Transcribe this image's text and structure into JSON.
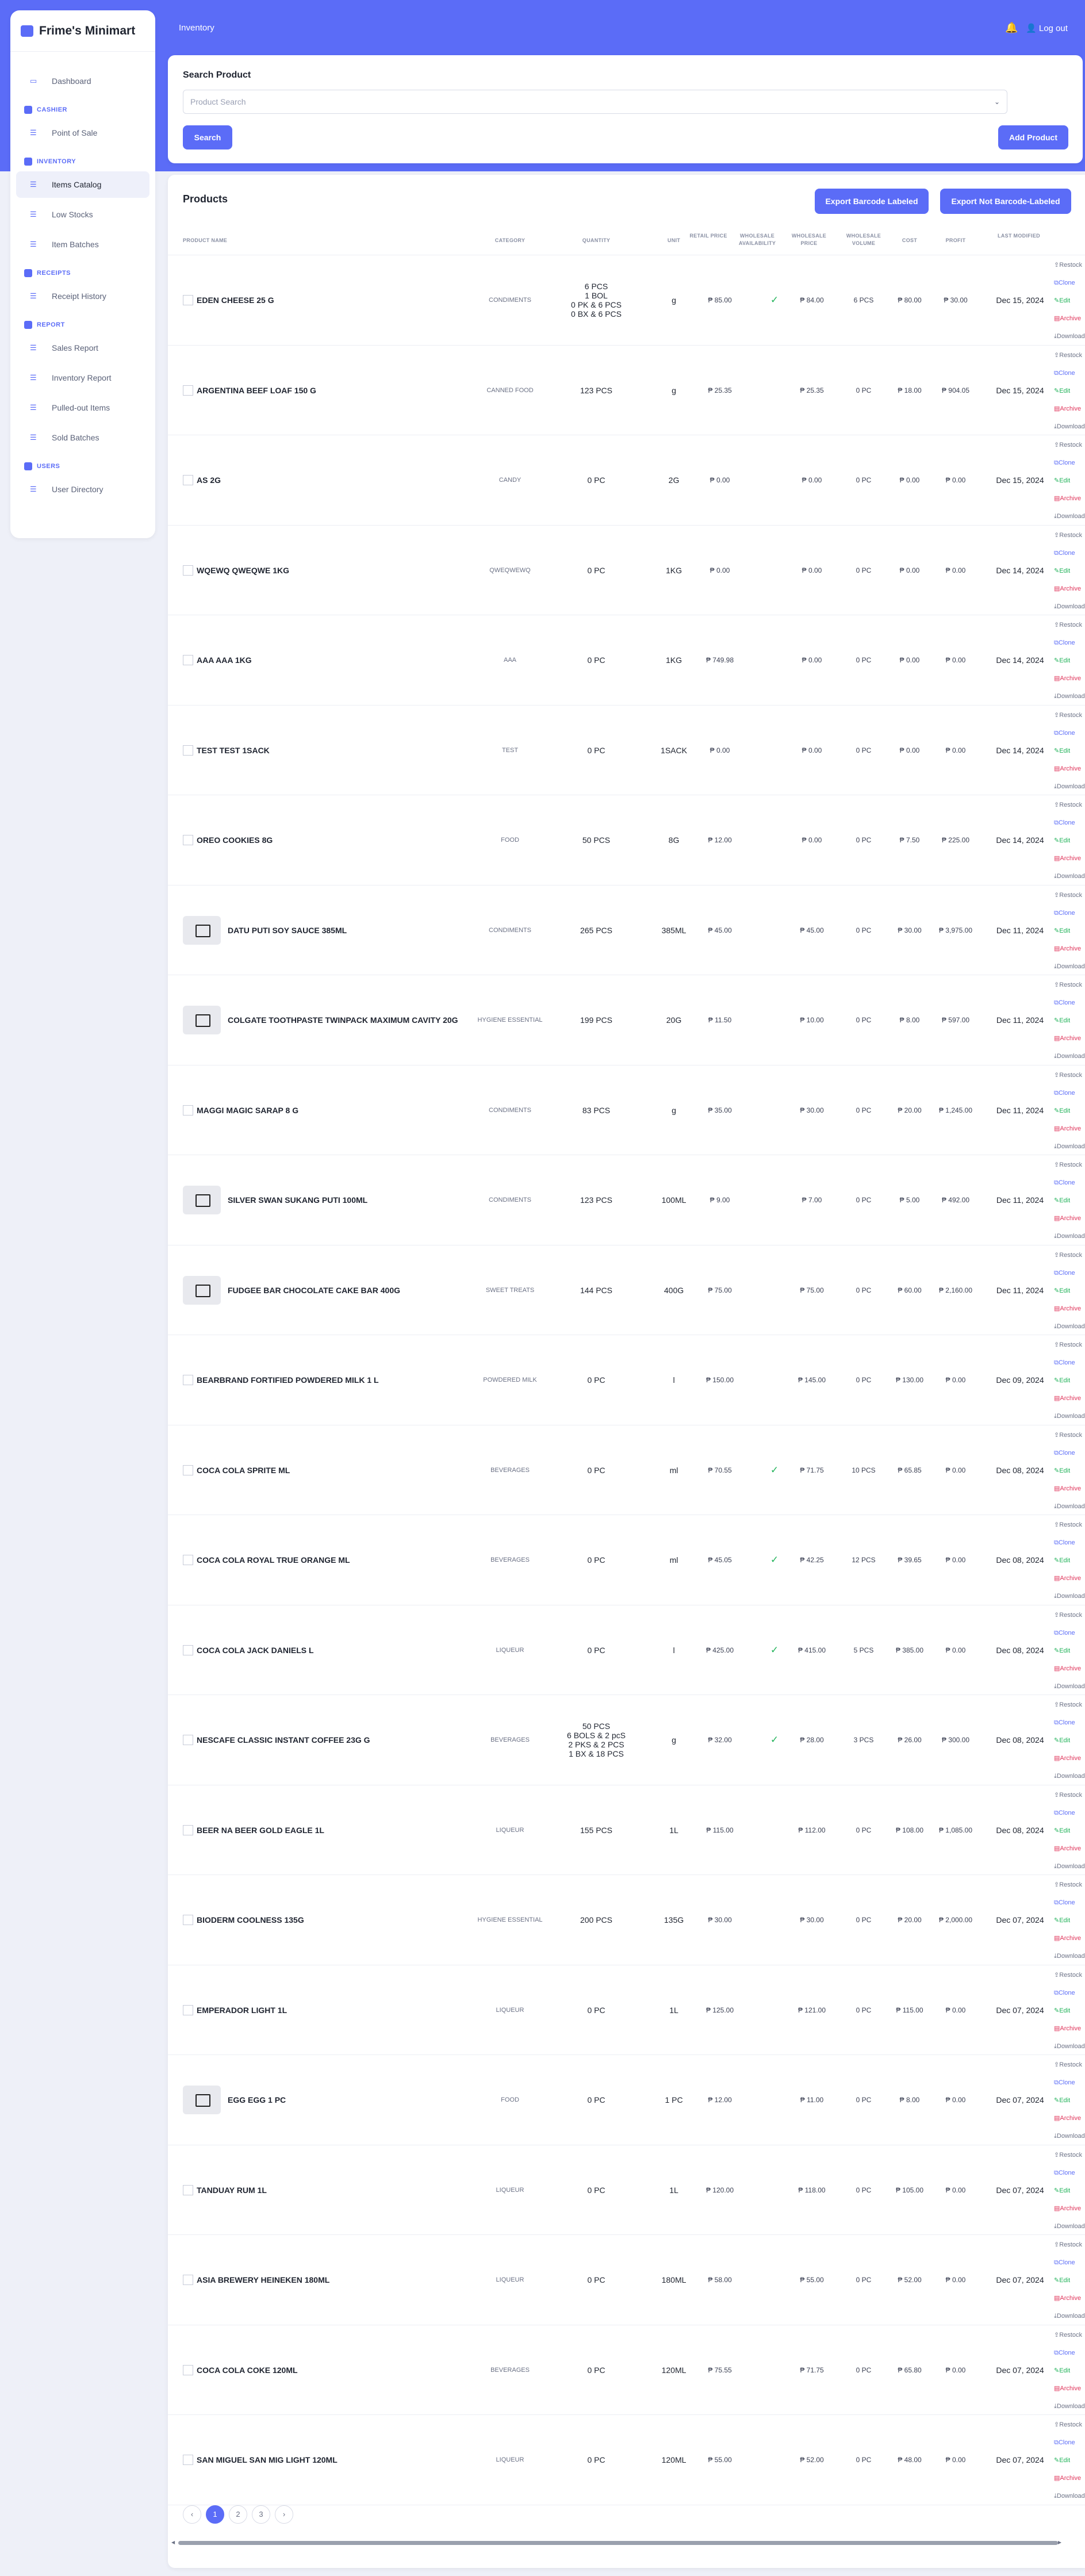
{
  "sidebar": {
    "brand": "Frime's Minimart",
    "dashboard": "Dashboard",
    "cashier_section": "CASHIER",
    "pos": "Point of Sale",
    "inventory_section": "INVENTORY",
    "items_catalog": "Items Catalog",
    "low_stocks": "Low Stocks",
    "item_batches": "Item Batches",
    "receipts_section": "RECEIPTS",
    "receipt_history": "Receipt History",
    "report_section": "REPORT",
    "sales_report": "Sales Report",
    "inventory_report": "Inventory Report",
    "pulled_out": "Pulled-out Items",
    "sold_batches": "Sold Batches",
    "users_section": "USERS",
    "user_directory": "User Directory"
  },
  "topbar": {
    "title": "Inventory",
    "logout": "Log out"
  },
  "search": {
    "label": "Search Product",
    "placeholder": "Product Search",
    "search_button": "Search",
    "add_button": "Add Product"
  },
  "table": {
    "heading": "Products",
    "export_labeled": "Export Barcode Labeled",
    "export_not_labeled": "Export Not Barcode-Labeled",
    "columns": {
      "product_name": "PRODUCT NAME",
      "category": "CATEGORY",
      "quantity": "QUANTITY",
      "unit": "UNIT",
      "retail_price": "RETAIL PRICE",
      "wholesale_availability": "WHOLESALE AVAILABILITY",
      "wholesale_price": "WHOLESALE PRICE",
      "wholesale_volume": "WHOLESALE VOLUME",
      "cost": "COST",
      "profit": "PROFIT",
      "last_modified": "LAST MODIFIED"
    },
    "actions": {
      "restock": "Restock",
      "clone": "Clone",
      "edit": "Edit",
      "archive": "Archive",
      "download": "Download"
    },
    "rows": [
      {
        "name": "EDEN CHEESE 25 G",
        "category": "CONDIMENTS",
        "qty": [
          "6 PCS",
          "1 BOL",
          "0 PK & 6 PCS",
          "0 BX & 6 PCS"
        ],
        "unit": "g",
        "retail": "₱ 85.00",
        "wholesale": "✓",
        "wprice": "₱ 84.00",
        "wvol": "6 PCS",
        "cost": "₱ 80.00",
        "profit": "₱ 30.00",
        "date": "Dec 15, 2024",
        "thumb": "broken"
      },
      {
        "name": "ARGENTINA BEEF LOAF 150 G",
        "category": "CANNED FOOD",
        "qty": [
          "123 PCS"
        ],
        "unit": "g",
        "retail": "₱ 25.35",
        "wholesale": "",
        "wprice": "₱ 25.35",
        "wvol": "0 PC",
        "cost": "₱ 18.00",
        "profit": "₱ 904.05",
        "date": "Dec 15, 2024",
        "thumb": "broken"
      },
      {
        "name": "AS 2G",
        "category": "CANDY",
        "qty": [
          "0 PC"
        ],
        "unit": "2G",
        "retail": "₱ 0.00",
        "wholesale": "",
        "wprice": "₱ 0.00",
        "wvol": "0 PC",
        "cost": "₱ 0.00",
        "profit": "₱ 0.00",
        "date": "Dec 15, 2024",
        "thumb": "broken"
      },
      {
        "name": "WQEWQ QWEQWE 1KG",
        "category": "QWEQWEWQ",
        "qty": [
          "0 PC"
        ],
        "unit": "1KG",
        "retail": "₱ 0.00",
        "wholesale": "",
        "wprice": "₱ 0.00",
        "wvol": "0 PC",
        "cost": "₱ 0.00",
        "profit": "₱ 0.00",
        "date": "Dec 14, 2024",
        "thumb": "broken"
      },
      {
        "name": "AAA AAA 1KG",
        "category": "AAA",
        "qty": [
          "0 PC"
        ],
        "unit": "1KG",
        "retail": "₱ 749.98",
        "wholesale": "",
        "wprice": "₱ 0.00",
        "wvol": "0 PC",
        "cost": "₱ 0.00",
        "profit": "₱ 0.00",
        "date": "Dec 14, 2024",
        "thumb": "broken"
      },
      {
        "name": "TEST TEST 1SACK",
        "category": "TEST",
        "qty": [
          "0 PC"
        ],
        "unit": "1SACK",
        "retail": "₱ 0.00",
        "wholesale": "",
        "wprice": "₱ 0.00",
        "wvol": "0 PC",
        "cost": "₱ 0.00",
        "profit": "₱ 0.00",
        "date": "Dec 14, 2024",
        "thumb": "broken"
      },
      {
        "name": "OREO COOKIES 8G",
        "category": "FOOD",
        "qty": [
          "50 PCS"
        ],
        "unit": "8G",
        "retail": "₱ 12.00",
        "wholesale": "",
        "wprice": "₱ 0.00",
        "wvol": "0 PC",
        "cost": "₱ 7.50",
        "profit": "₱ 225.00",
        "date": "Dec 14, 2024",
        "thumb": "broken"
      },
      {
        "name": "DATU PUTI SOY SAUCE 385ML",
        "category": "CONDIMENTS",
        "qty": [
          "265 PCS"
        ],
        "unit": "385ML",
        "retail": "₱ 45.00",
        "wholesale": "",
        "wprice": "₱ 45.00",
        "wvol": "0 PC",
        "cost": "₱ 30.00",
        "profit": "₱ 3,975.00",
        "date": "Dec 11, 2024",
        "thumb": "box"
      },
      {
        "name": "COLGATE TOOTHPASTE TWINPACK MAXIMUM CAVITY 20G",
        "category": "HYGIENE ESSENTIAL",
        "qty": [
          "199 PCS"
        ],
        "unit": "20G",
        "retail": "₱ 11.50",
        "wholesale": "",
        "wprice": "₱ 10.00",
        "wvol": "0 PC",
        "cost": "₱ 8.00",
        "profit": "₱ 597.00",
        "date": "Dec 11, 2024",
        "thumb": "box"
      },
      {
        "name": "MAGGI MAGIC SARAP 8 G",
        "category": "CONDIMENTS",
        "qty": [
          "83 PCS"
        ],
        "unit": "g",
        "retail": "₱ 35.00",
        "wholesale": "",
        "wprice": "₱ 30.00",
        "wvol": "0 PC",
        "cost": "₱ 20.00",
        "profit": "₱ 1,245.00",
        "date": "Dec 11, 2024",
        "thumb": "broken"
      },
      {
        "name": "SILVER SWAN SUKANG PUTI 100ML",
        "category": "CONDIMENTS",
        "qty": [
          "123 PCS"
        ],
        "unit": "100ML",
        "retail": "₱ 9.00",
        "wholesale": "",
        "wprice": "₱ 7.00",
        "wvol": "0 PC",
        "cost": "₱ 5.00",
        "profit": "₱ 492.00",
        "date": "Dec 11, 2024",
        "thumb": "box"
      },
      {
        "name": "FUDGEE BAR CHOCOLATE CAKE BAR 400G",
        "category": "SWEET TREATS",
        "qty": [
          "144 PCS"
        ],
        "unit": "400G",
        "retail": "₱ 75.00",
        "wholesale": "",
        "wprice": "₱ 75.00",
        "wvol": "0 PC",
        "cost": "₱ 60.00",
        "profit": "₱ 2,160.00",
        "date": "Dec 11, 2024",
        "thumb": "box"
      },
      {
        "name": "BEARBRAND FORTIFIED POWDERED MILK 1 L",
        "category": "POWDERED MILK",
        "qty": [
          "0 PC"
        ],
        "unit": "l",
        "retail": "₱ 150.00",
        "wholesale": "",
        "wprice": "₱ 145.00",
        "wvol": "0 PC",
        "cost": "₱ 130.00",
        "profit": "₱ 0.00",
        "date": "Dec 09, 2024",
        "thumb": "broken"
      },
      {
        "name": "COCA COLA SPRITE ML",
        "category": "BEVERAGES",
        "qty": [
          "0 PC"
        ],
        "unit": "ml",
        "retail": "₱ 70.55",
        "wholesale": "✓",
        "wprice": "₱ 71.75",
        "wvol": "10 PCS",
        "cost": "₱ 65.85",
        "profit": "₱ 0.00",
        "date": "Dec 08, 2024",
        "thumb": "broken"
      },
      {
        "name": "COCA COLA ROYAL TRUE ORANGE ML",
        "category": "BEVERAGES",
        "qty": [
          "0 PC"
        ],
        "unit": "ml",
        "retail": "₱ 45.05",
        "wholesale": "✓",
        "wprice": "₱ 42.25",
        "wvol": "12 PCS",
        "cost": "₱ 39.65",
        "profit": "₱ 0.00",
        "date": "Dec 08, 2024",
        "thumb": "broken"
      },
      {
        "name": "COCA COLA JACK DANIELS L",
        "category": "LIQUEUR",
        "qty": [
          "0 PC"
        ],
        "unit": "l",
        "retail": "₱ 425.00",
        "wholesale": "✓",
        "wprice": "₱ 415.00",
        "wvol": "5 PCS",
        "cost": "₱ 385.00",
        "profit": "₱ 0.00",
        "date": "Dec 08, 2024",
        "thumb": "broken"
      },
      {
        "name": "NESCAFE CLASSIC INSTANT COFFEE 23G G",
        "category": "BEVERAGES",
        "qty": [
          "50 PCS",
          "6 BOLS & 2 pcS",
          "2 PKS & 2 PCS",
          "1 BX & 18 PCS"
        ],
        "unit": "g",
        "retail": "₱ 32.00",
        "wholesale": "✓",
        "wprice": "₱ 28.00",
        "wvol": "3 PCS",
        "cost": "₱ 26.00",
        "profit": "₱ 300.00",
        "date": "Dec 08, 2024",
        "thumb": "broken"
      },
      {
        "name": "BEER NA BEER GOLD EAGLE 1L",
        "category": "LIQUEUR",
        "qty": [
          "155 PCS"
        ],
        "unit": "1L",
        "retail": "₱ 115.00",
        "wholesale": "",
        "wprice": "₱ 112.00",
        "wvol": "0 PC",
        "cost": "₱ 108.00",
        "profit": "₱ 1,085.00",
        "date": "Dec 08, 2024",
        "thumb": "broken"
      },
      {
        "name": "BIODERM COOLNESS 135G",
        "category": "HYGIENE ESSENTIAL",
        "qty": [
          "200 PCS"
        ],
        "unit": "135G",
        "retail": "₱ 30.00",
        "wholesale": "",
        "wprice": "₱ 30.00",
        "wvol": "0 PC",
        "cost": "₱ 20.00",
        "profit": "₱ 2,000.00",
        "date": "Dec 07, 2024",
        "thumb": "broken"
      },
      {
        "name": "EMPERADOR LIGHT 1L",
        "category": "LIQUEUR",
        "qty": [
          "0 PC"
        ],
        "unit": "1L",
        "retail": "₱ 125.00",
        "wholesale": "",
        "wprice": "₱ 121.00",
        "wvol": "0 PC",
        "cost": "₱ 115.00",
        "profit": "₱ 0.00",
        "date": "Dec 07, 2024",
        "thumb": "broken"
      },
      {
        "name": "EGG EGG 1 PC",
        "category": "FOOD",
        "qty": [
          "0 PC"
        ],
        "unit": "1 PC",
        "retail": "₱ 12.00",
        "wholesale": "",
        "wprice": "₱ 11.00",
        "wvol": "0 PC",
        "cost": "₱ 8.00",
        "profit": "₱ 0.00",
        "date": "Dec 07, 2024",
        "thumb": "box"
      },
      {
        "name": "TANDUAY RUM 1L",
        "category": "LIQUEUR",
        "qty": [
          "0 PC"
        ],
        "unit": "1L",
        "retail": "₱ 120.00",
        "wholesale": "",
        "wprice": "₱ 118.00",
        "wvol": "0 PC",
        "cost": "₱ 105.00",
        "profit": "₱ 0.00",
        "date": "Dec 07, 2024",
        "thumb": "broken"
      },
      {
        "name": "ASIA BREWERY HEINEKEN 180ML",
        "category": "LIQUEUR",
        "qty": [
          "0 PC"
        ],
        "unit": "180ML",
        "retail": "₱ 58.00",
        "wholesale": "",
        "wprice": "₱ 55.00",
        "wvol": "0 PC",
        "cost": "₱ 52.00",
        "profit": "₱ 0.00",
        "date": "Dec 07, 2024",
        "thumb": "broken"
      },
      {
        "name": "COCA COLA COKE 120ML",
        "category": "BEVERAGES",
        "qty": [
          "0 PC"
        ],
        "unit": "120ML",
        "retail": "₱ 75.55",
        "wholesale": "",
        "wprice": "₱ 71.75",
        "wvol": "0 PC",
        "cost": "₱ 65.80",
        "profit": "₱ 0.00",
        "date": "Dec 07, 2024",
        "thumb": "broken"
      },
      {
        "name": "SAN MIGUEL SAN MIG LIGHT 120ML",
        "category": "LIQUEUR",
        "qty": [
          "0 PC"
        ],
        "unit": "120ML",
        "retail": "₱ 55.00",
        "wholesale": "",
        "wprice": "₱ 52.00",
        "wvol": "0 PC",
        "cost": "₱ 48.00",
        "profit": "₱ 0.00",
        "date": "Dec 07, 2024",
        "thumb": "broken"
      }
    ]
  },
  "pagination": {
    "prev": "‹",
    "pages": [
      "1",
      "2",
      "3"
    ],
    "next": "›",
    "current": "1"
  },
  "colors": {
    "accent": "#5b6cf7",
    "edit": "#22b35a",
    "archive": "#e0345a"
  }
}
